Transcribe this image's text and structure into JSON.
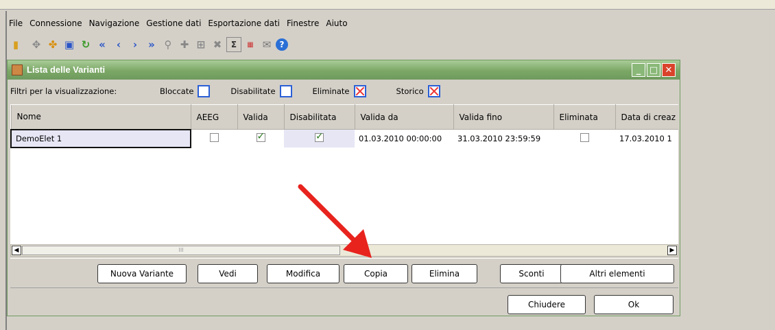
{
  "menu": [
    "File",
    "Connessione",
    "Navigazione",
    "Gestione dati",
    "Esportazione dati",
    "Finestre",
    "Aiuto"
  ],
  "window": {
    "title": "Lista delle Varianti"
  },
  "filters": {
    "label": "Filtri per la visualizzazione:",
    "bloccate": "Bloccate",
    "disabilitate": "Disabilitate",
    "eliminate": "Eliminate",
    "storico": "Storico"
  },
  "table": {
    "headers": [
      "Nome",
      "AEEG",
      "Valida",
      "Disabilitata",
      "Valida da",
      "Valida fino",
      "Eliminata",
      "Data di creaz"
    ],
    "rows": [
      {
        "nome": "DemoElet 1",
        "aeeg": false,
        "valida": true,
        "disabilitata": true,
        "valida_da": "01.03.2010 00:00:00",
        "valida_fino": "31.03.2010 23:59:59",
        "eliminata": false,
        "data_creazione": "17.03.2010 1"
      }
    ]
  },
  "scroll": {
    "thumb": "III"
  },
  "buttons": {
    "nuova": "Nuova Variante",
    "vedi": "Vedi",
    "modifica": "Modifica",
    "copia": "Copia",
    "elimina": "Elimina",
    "sconti": "Sconti",
    "altri": "Altri elementi",
    "chiudere": "Chiudere",
    "ok": "Ok"
  },
  "colors": {
    "accent": "#7ba766",
    "annotation_arrow": "#e8231e",
    "checkbox_border": "#2a5fd6"
  }
}
